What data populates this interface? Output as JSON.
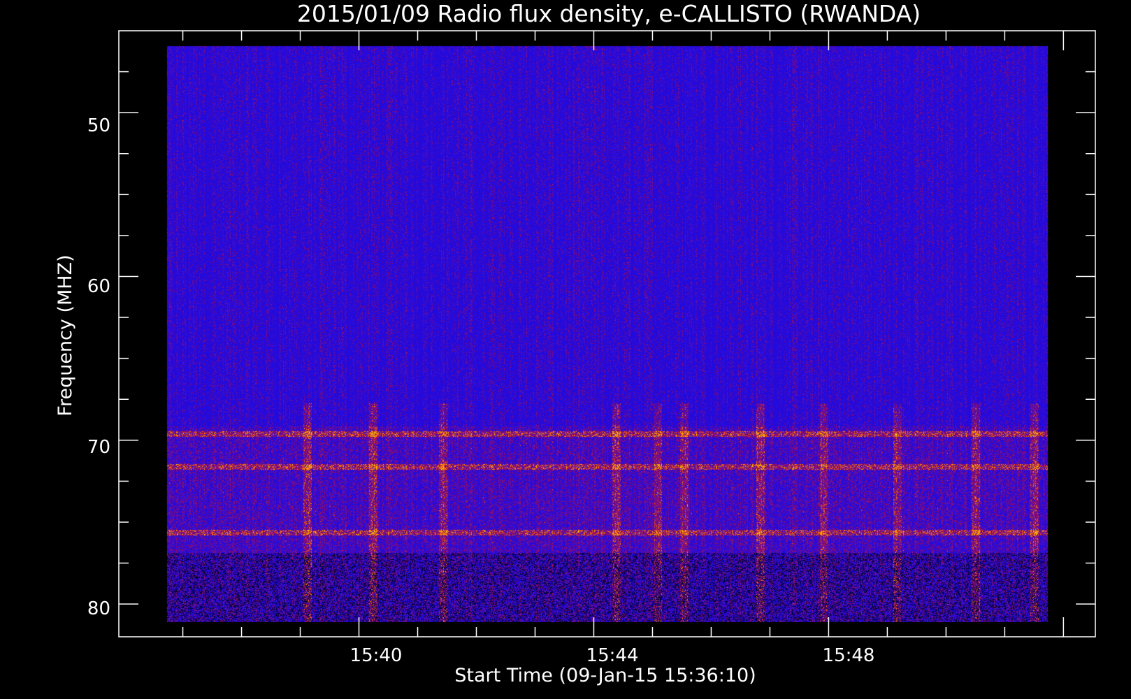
{
  "chart_data": {
    "type": "heatmap",
    "title": "2015/01/09  Radio flux density, e-CALLISTO (RWANDA)",
    "xlabel": "Start Time (09-Jan-15 15:36:10)",
    "ylabel": "Frequency (MHZ)",
    "x_ticks": [
      "15:40",
      "15:44",
      "15:48"
    ],
    "y_ticks": [
      "50",
      "60",
      "70",
      "80"
    ],
    "x_tick_values_min": [
      240,
      480,
      720
    ],
    "y_tick_values": [
      50,
      60,
      70,
      80
    ],
    "xlim_min": [
      -5.4,
      992.6
    ],
    "data_xlim_min": [
      43.8,
      943.5
    ],
    "ylim": [
      45,
      82
    ],
    "data_ylim": [
      45.9,
      81.9
    ],
    "y_inverted": true,
    "colormap": "blue-red-yellow (low to high intensity)",
    "colors": {
      "background": "#000000",
      "low": "#0c0cff",
      "mid": "#cc1500",
      "high": "#ffc800"
    },
    "bright_bands_mhz": [
      69.6,
      71.6,
      75.6
    ],
    "bright_times_min": [
      187,
      254,
      326,
      503,
      545,
      572,
      650,
      715,
      790,
      870,
      930
    ]
  }
}
